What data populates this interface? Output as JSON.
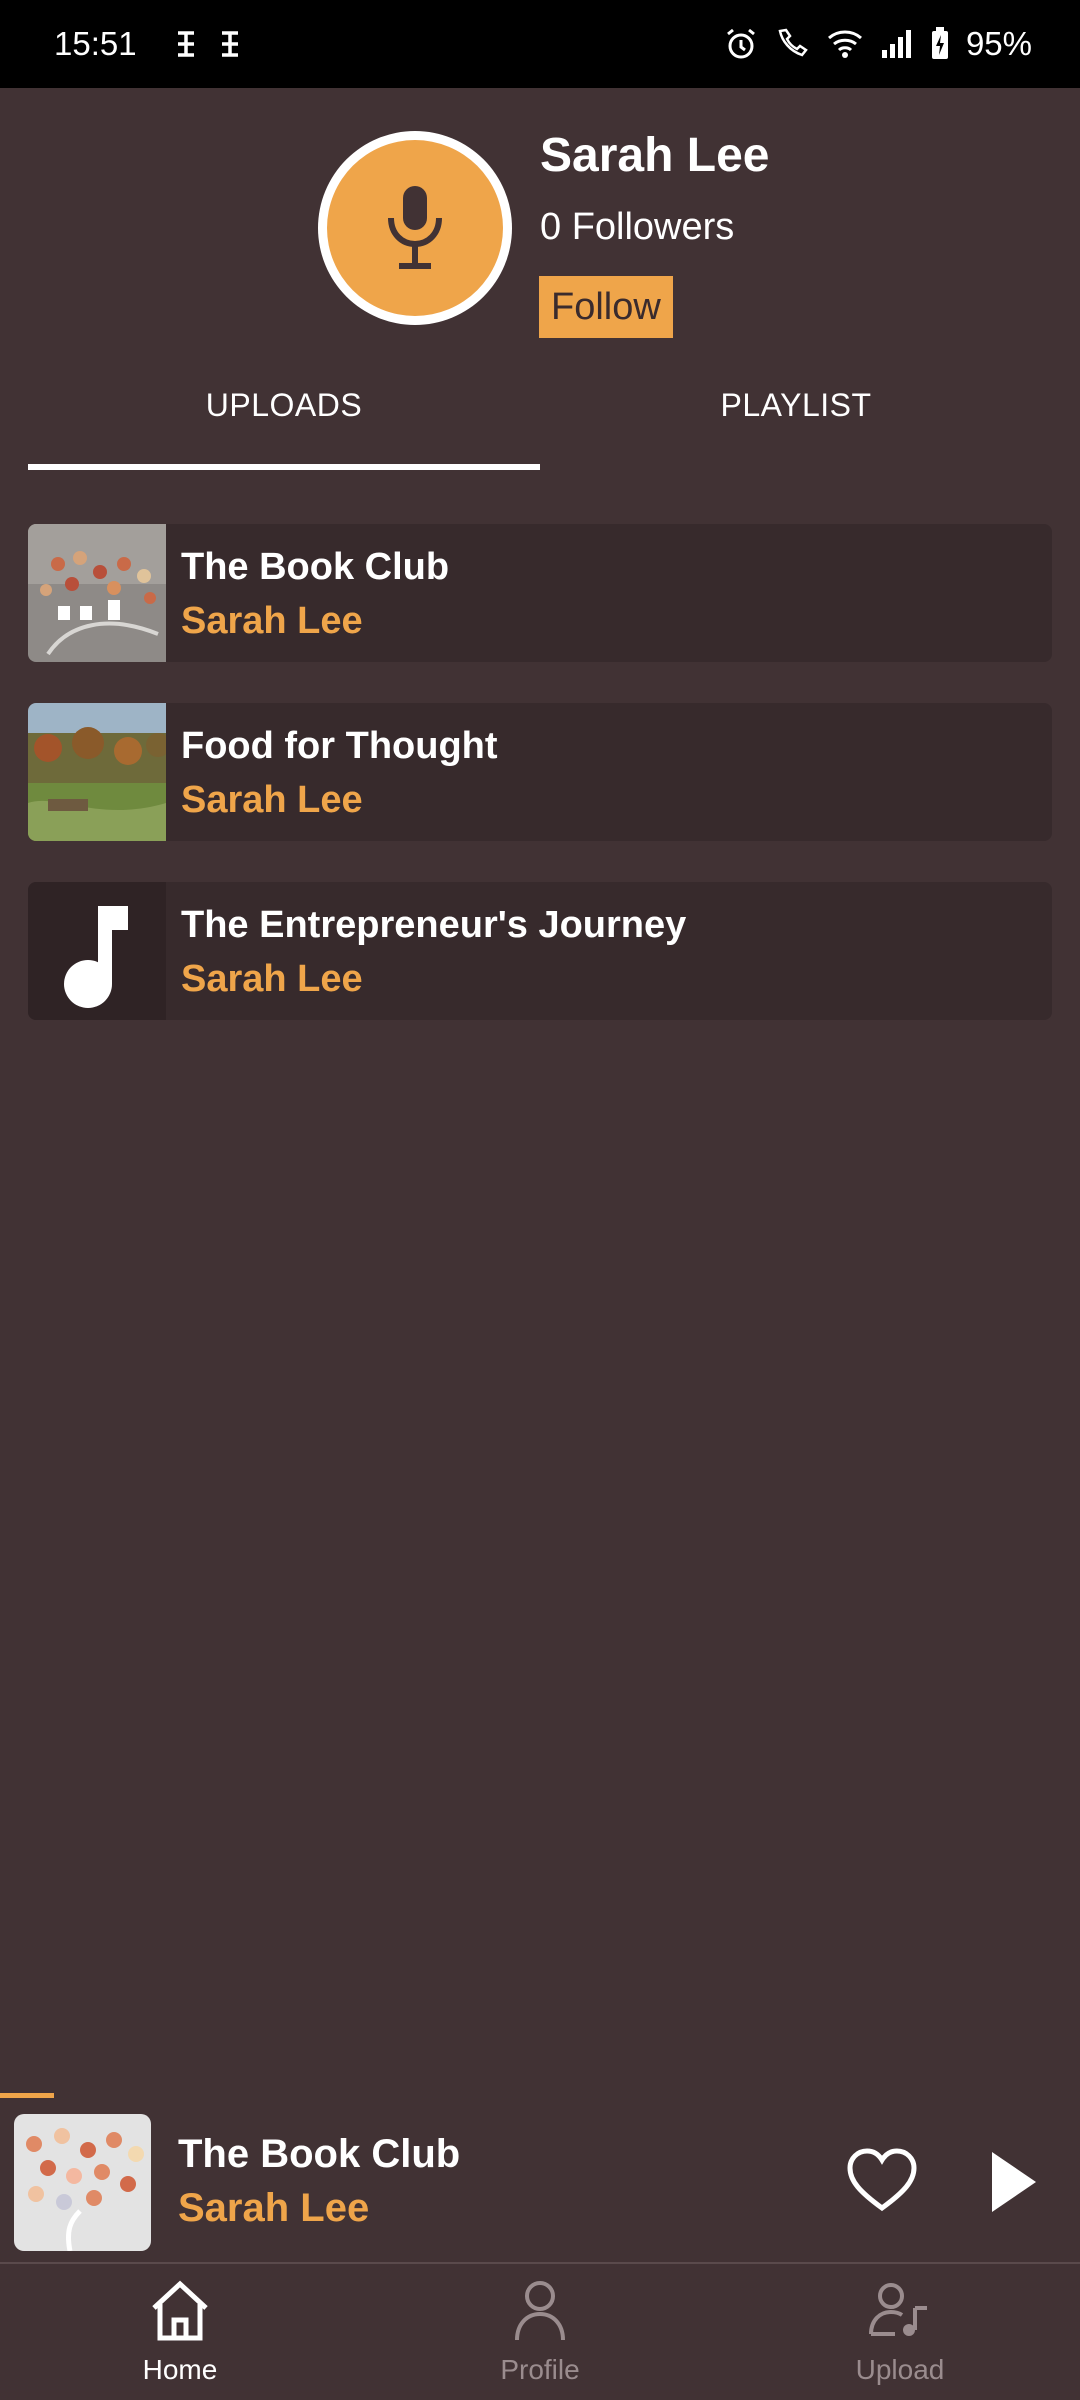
{
  "status_bar": {
    "time": "15:51",
    "battery": "95%"
  },
  "profile": {
    "name": "Sarah Lee",
    "followers": "0 Followers",
    "follow_label": "Follow"
  },
  "tabs": [
    {
      "label": "UPLOADS",
      "active": true
    },
    {
      "label": "PLAYLIST",
      "active": false
    }
  ],
  "uploads": [
    {
      "title": "The Book Club",
      "artist": "Sarah Lee",
      "thumb": "macarons-image"
    },
    {
      "title": "Food for Thought",
      "artist": "Sarah Lee",
      "thumb": "landscape-image"
    },
    {
      "title": "The Entrepreneur's Journey",
      "artist": "Sarah Lee",
      "thumb": "music-note-icon"
    }
  ],
  "player": {
    "title": "The Book Club",
    "artist": "Sarah Lee",
    "progress": 0.05
  },
  "nav": [
    {
      "label": "Home",
      "active": true
    },
    {
      "label": "Profile",
      "active": false
    },
    {
      "label": "Upload",
      "active": false
    }
  ],
  "colors": {
    "background": "#413234",
    "accent": "#efa54a",
    "card": "#372a2c"
  }
}
